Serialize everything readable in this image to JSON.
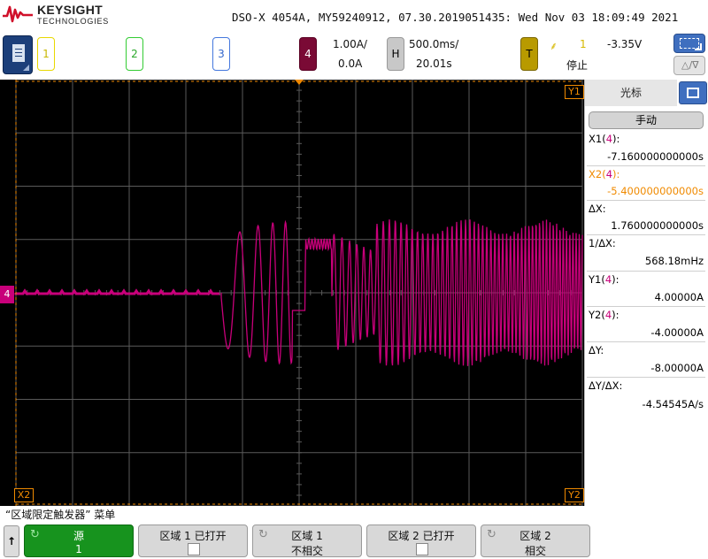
{
  "header": {
    "brand": "KEYSIGHT",
    "brand_sub": "TECHNOLOGIES",
    "status_line": "DSO-X 4054A, MY59240912, 07.30.2019051435: Wed Nov 03 18:09:49 2021"
  },
  "channels": [
    {
      "number": "1",
      "color": "#e8d800",
      "scale": "",
      "offset": ""
    },
    {
      "number": "2",
      "color": "#33cc33",
      "scale": "",
      "offset": ""
    },
    {
      "number": "3",
      "color": "#4477dd",
      "scale": "",
      "offset": ""
    },
    {
      "number": "4",
      "color": "#c8007a",
      "scale": "1.00A/",
      "offset": "0.0A"
    }
  ],
  "horizontal": {
    "label": "H",
    "scale": "500.0ms/",
    "delay": "20.01s"
  },
  "trigger": {
    "label": "T",
    "source": "1",
    "level": "-3.35V",
    "state": "停止"
  },
  "scope_markers": {
    "channel_marker": "4",
    "y1": "Y1",
    "y2": "Y2",
    "x2": "X2"
  },
  "cursors_panel": {
    "title": "光标",
    "mode": "手动",
    "x1_label_prefix": "X1(",
    "x1_label_ch": "4",
    "x1_label_suffix": "):",
    "x1_value": "-7.160000000000s",
    "x2_label_prefix": "X2(",
    "x2_label_ch": "4",
    "x2_label_suffix": "):",
    "x2_value": "-5.400000000000s",
    "dx_label": "ΔX:",
    "dx_value": "1.760000000000s",
    "inv_dx_label": "1/ΔX:",
    "inv_dx_value": "568.18mHz",
    "y1_label_prefix": "Y1(",
    "y1_label_ch": "4",
    "y1_label_suffix": "):",
    "y1_value": "4.00000A",
    "y2_label_prefix": "Y2(",
    "y2_label_ch": "4",
    "y2_label_suffix": "):",
    "y2_value": "-4.00000A",
    "dy_label": "ΔY:",
    "dy_value": "-8.00000A",
    "dydx_label": "ΔY/ΔX:",
    "dydx_value": "-4.54545A/s"
  },
  "softkey_menu": {
    "title": "“区域限定触发器” 菜单",
    "back": "↑",
    "keys": [
      {
        "line1": "源",
        "line2": "1"
      },
      {
        "line1": "区域 1 已打开",
        "line2": ""
      },
      {
        "line1": "区域 1",
        "line2": "不相交"
      },
      {
        "line1": "区域 2 已打开",
        "line2": ""
      },
      {
        "line1": "区域 2",
        "line2": "相交"
      }
    ]
  },
  "colors": {
    "trace": "#c8007a",
    "grid": "#5a5a5a",
    "trigger": "#f08a00",
    "softkey_active": "#17931e"
  }
}
